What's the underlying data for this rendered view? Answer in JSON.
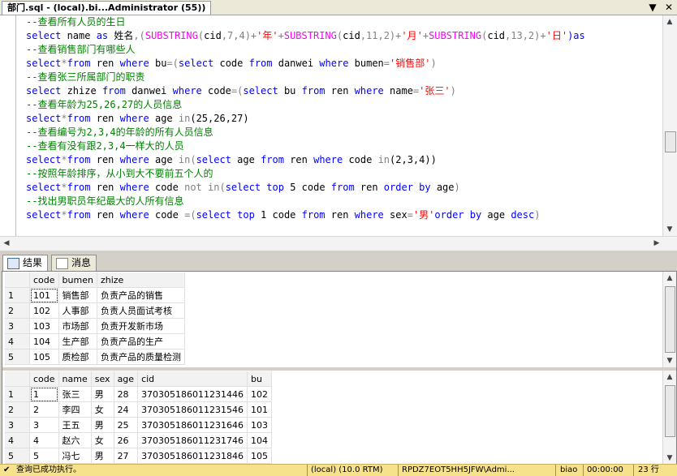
{
  "window": {
    "tab_title": "部门.sql - (local).bi...Administrator (55))",
    "dropdown_glyph": "▼",
    "close_glyph": "✕"
  },
  "editor": {
    "lines": [
      [
        {
          "t": "--查看所有人员的生日",
          "c": "cm"
        }
      ],
      [
        {
          "t": "select ",
          "c": "kw"
        },
        {
          "t": "name ",
          "c": "id"
        },
        {
          "t": "as ",
          "c": "kw"
        },
        {
          "t": "姓名",
          "c": "id"
        },
        {
          "t": ",(",
          "c": "op"
        },
        {
          "t": "SUBSTRING",
          "c": "fn"
        },
        {
          "t": "(",
          "c": "op"
        },
        {
          "t": "cid",
          "c": "id"
        },
        {
          "t": ",7,4)+",
          "c": "op"
        },
        {
          "t": "'年'",
          "c": "str"
        },
        {
          "t": "+",
          "c": "op"
        },
        {
          "t": "SUBSTRING",
          "c": "fn"
        },
        {
          "t": "(",
          "c": "op"
        },
        {
          "t": "cid",
          "c": "id"
        },
        {
          "t": ",11,2)+",
          "c": "op"
        },
        {
          "t": "'月'",
          "c": "str"
        },
        {
          "t": "+",
          "c": "op"
        },
        {
          "t": "SUBSTRING",
          "c": "fn"
        },
        {
          "t": "(",
          "c": "op"
        },
        {
          "t": "cid",
          "c": "id"
        },
        {
          "t": ",13,2)+",
          "c": "op"
        },
        {
          "t": "'日'",
          "c": "str"
        },
        {
          "t": ")as ",
          "c": "kw"
        }
      ],
      [
        {
          "t": "--查看销售部门有哪些人",
          "c": "cm"
        }
      ],
      [
        {
          "t": "select",
          "c": "kw"
        },
        {
          "t": "*",
          "c": "op"
        },
        {
          "t": "from ",
          "c": "kw"
        },
        {
          "t": "ren ",
          "c": "id"
        },
        {
          "t": "where ",
          "c": "kw"
        },
        {
          "t": "bu",
          "c": "id"
        },
        {
          "t": "=(",
          "c": "op"
        },
        {
          "t": "select ",
          "c": "kw"
        },
        {
          "t": "code ",
          "c": "id"
        },
        {
          "t": "from ",
          "c": "kw"
        },
        {
          "t": "danwei ",
          "c": "id"
        },
        {
          "t": "where ",
          "c": "kw"
        },
        {
          "t": "bumen",
          "c": "id"
        },
        {
          "t": "=",
          "c": "op"
        },
        {
          "t": "'销售部'",
          "c": "str"
        },
        {
          "t": ")",
          "c": "op"
        }
      ],
      [
        {
          "t": "--查看张三所属部门的职责",
          "c": "cm"
        }
      ],
      [
        {
          "t": "select ",
          "c": "kw"
        },
        {
          "t": "zhize ",
          "c": "id"
        },
        {
          "t": "from ",
          "c": "kw"
        },
        {
          "t": "danwei ",
          "c": "id"
        },
        {
          "t": "where ",
          "c": "kw"
        },
        {
          "t": "code",
          "c": "id"
        },
        {
          "t": "=(",
          "c": "op"
        },
        {
          "t": "select ",
          "c": "kw"
        },
        {
          "t": "bu ",
          "c": "id"
        },
        {
          "t": "from ",
          "c": "kw"
        },
        {
          "t": "ren ",
          "c": "id"
        },
        {
          "t": "where ",
          "c": "kw"
        },
        {
          "t": "name",
          "c": "id"
        },
        {
          "t": "=",
          "c": "op"
        },
        {
          "t": "'张三'",
          "c": "str"
        },
        {
          "t": ")",
          "c": "op"
        }
      ],
      [
        {
          "t": "--查看年龄为25,26,27的人员信息",
          "c": "cm"
        }
      ],
      [
        {
          "t": "select",
          "c": "kw"
        },
        {
          "t": "*",
          "c": "op"
        },
        {
          "t": "from ",
          "c": "kw"
        },
        {
          "t": "ren ",
          "c": "id"
        },
        {
          "t": "where ",
          "c": "kw"
        },
        {
          "t": "age ",
          "c": "id"
        },
        {
          "t": "in",
          "c": "op"
        },
        {
          "t": "(25,26,27)",
          "c": "id"
        }
      ],
      [
        {
          "t": "--查看编号为2,3,4的年龄的所有人员信息",
          "c": "cm"
        }
      ],
      [
        {
          "t": "--查看有没有跟2,3,4一样大的人员",
          "c": "cm"
        }
      ],
      [
        {
          "t": "select",
          "c": "kw"
        },
        {
          "t": "*",
          "c": "op"
        },
        {
          "t": "from ",
          "c": "kw"
        },
        {
          "t": "ren ",
          "c": "id"
        },
        {
          "t": "where ",
          "c": "kw"
        },
        {
          "t": "age ",
          "c": "id"
        },
        {
          "t": "in",
          "c": "op"
        },
        {
          "t": "(",
          "c": "op"
        },
        {
          "t": "select ",
          "c": "kw"
        },
        {
          "t": "age ",
          "c": "id"
        },
        {
          "t": "from ",
          "c": "kw"
        },
        {
          "t": "ren ",
          "c": "id"
        },
        {
          "t": "where ",
          "c": "kw"
        },
        {
          "t": "code ",
          "c": "id"
        },
        {
          "t": "in",
          "c": "op"
        },
        {
          "t": "(2,3,4))",
          "c": "id"
        }
      ],
      [
        {
          "t": "--按照年龄排序，从小到大不要前五个人的",
          "c": "cm"
        }
      ],
      [
        {
          "t": "select",
          "c": "kw"
        },
        {
          "t": "*",
          "c": "op"
        },
        {
          "t": "from ",
          "c": "kw"
        },
        {
          "t": "ren ",
          "c": "id"
        },
        {
          "t": "where ",
          "c": "kw"
        },
        {
          "t": "code ",
          "c": "id"
        },
        {
          "t": "not in",
          "c": "op"
        },
        {
          "t": "(",
          "c": "op"
        },
        {
          "t": "select ",
          "c": "kw"
        },
        {
          "t": "top ",
          "c": "kw"
        },
        {
          "t": "5 ",
          "c": "id"
        },
        {
          "t": "code ",
          "c": "id"
        },
        {
          "t": "from ",
          "c": "kw"
        },
        {
          "t": "ren ",
          "c": "id"
        },
        {
          "t": "order by ",
          "c": "kw"
        },
        {
          "t": "age",
          "c": "id"
        },
        {
          "t": ")",
          "c": "op"
        }
      ],
      [
        {
          "t": "--找出男职员年纪最大的人所有信息",
          "c": "cm"
        }
      ],
      [
        {
          "t": "select",
          "c": "kw"
        },
        {
          "t": "*",
          "c": "op"
        },
        {
          "t": "from ",
          "c": "kw"
        },
        {
          "t": "ren ",
          "c": "id"
        },
        {
          "t": "where ",
          "c": "kw"
        },
        {
          "t": "code ",
          "c": "id"
        },
        {
          "t": "=(",
          "c": "op"
        },
        {
          "t": "select ",
          "c": "kw"
        },
        {
          "t": "top ",
          "c": "kw"
        },
        {
          "t": "1 ",
          "c": "id"
        },
        {
          "t": "code ",
          "c": "id"
        },
        {
          "t": "from ",
          "c": "kw"
        },
        {
          "t": "ren ",
          "c": "id"
        },
        {
          "t": "where ",
          "c": "kw"
        },
        {
          "t": "sex",
          "c": "id"
        },
        {
          "t": "=",
          "c": "op"
        },
        {
          "t": "'男'",
          "c": "str"
        },
        {
          "t": "order by ",
          "c": "kw"
        },
        {
          "t": "age ",
          "c": "id"
        },
        {
          "t": "desc",
          "c": "kw"
        },
        {
          "t": ")",
          "c": "op"
        }
      ]
    ]
  },
  "result_tabs": [
    {
      "label": "结果",
      "active": true
    },
    {
      "label": "消息",
      "active": false
    }
  ],
  "grid1": {
    "columns": [
      "code",
      "bumen",
      "zhize"
    ],
    "rows": [
      [
        "1",
        "101",
        "销售部",
        "负责产品的销售"
      ],
      [
        "2",
        "102",
        "人事部",
        "负责人员面试考核"
      ],
      [
        "3",
        "103",
        "市场部",
        "负责开发新市场"
      ],
      [
        "4",
        "104",
        "生产部",
        "负责产品的生产"
      ],
      [
        "5",
        "105",
        "质检部",
        "负责产品的质量检测"
      ]
    ]
  },
  "grid2": {
    "columns": [
      "code",
      "name",
      "sex",
      "age",
      "cid",
      "bu"
    ],
    "rows": [
      [
        "1",
        "1",
        "张三",
        "男",
        "28",
        "370305186011231446",
        "102"
      ],
      [
        "2",
        "2",
        "李四",
        "女",
        "24",
        "370305186011231546",
        "101"
      ],
      [
        "3",
        "3",
        "王五",
        "男",
        "25",
        "370305186011231646",
        "103"
      ],
      [
        "4",
        "4",
        "赵六",
        "女",
        "26",
        "370305186011231746",
        "104"
      ],
      [
        "5",
        "5",
        "冯七",
        "男",
        "27",
        "370305186011231846",
        "105"
      ]
    ]
  },
  "statusbar": {
    "message": "查询已成功执行。",
    "server": "(local) (10.0 RTM)",
    "login": "RPDZ7EOT5HH5JFW\\Admi...",
    "database": "biao",
    "elapsed": "00:00:00",
    "row_count": "23 行"
  }
}
